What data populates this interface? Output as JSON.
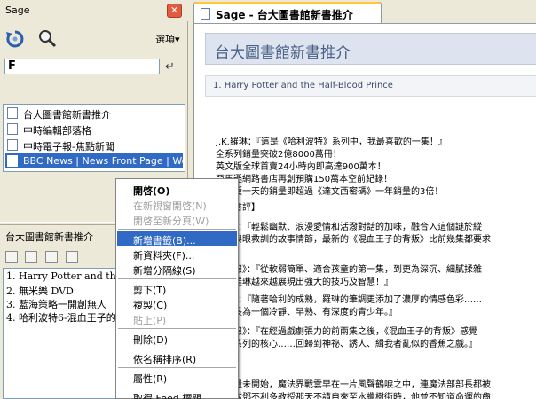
{
  "sidebar": {
    "title": "Sage",
    "close_glyph": "✕",
    "toolbar": {
      "refresh_icon": "refresh-icon",
      "search_icon": "search-icon",
      "options_label": "選項▾"
    },
    "filter": {
      "value": "F",
      "go_glyph": "↵"
    },
    "feeds": [
      {
        "label": "台大圖書館新書推介",
        "selected": false
      },
      {
        "label": "中時編輯部落格",
        "selected": false
      },
      {
        "label": "中時電子報-焦點新聞",
        "selected": false
      },
      {
        "label": "BBC News | News Front Page | World E",
        "selected": true
      }
    ],
    "item_list": {
      "title": "台大圖書館新書推介",
      "items": [
        "1. Harry Potter and the Ha",
        "2. 無米樂 DVD",
        "3. 藍海策略一開創無人",
        "4. 哈利波特6-混血王子的"
      ]
    }
  },
  "main": {
    "tab_label": "Sage - 台大圖書館新書推介",
    "page_title": "台大圖書館新書推介",
    "item_heading": "1.  Harry Potter and the Half-Blood Prince",
    "article_lines": [
      "J.K.羅琳：『這是《哈利波特》系列中，我最喜歡的一集！』",
      "全系列銷量突破2億8000萬冊！",
      "英文版全球首賣24小時內即高達900萬本！",
      "亞馬遜網路書店再創預購150萬本空前紀錄！",
      "英文版一天的銷量即超過《達文西密碼》一年銷量的3倍！",
      "重要書評】",
      "時報》：『輕鬆幽默、浪漫愛情和活潑對話的加味，融合入這個謎於縱",
      "誘和與眼救訓的故事情節，最新的《混血王子的背叛》比前幾集都要求",
      "」",
      "頂日報》：『從軟弱簡單、適合孩童的第一集，到更為深沉、細膩揉雜",
      "集，羅琳越來越展現出強大的技巧及智慧！』",
      "信報》：『隨著哈利的成熟，羅琳的筆調更添加了濃厚的情感色彩……",
      "漸成長為一個冷靜、早熟、有深度的青少年。』",
      "國日報》：『在經過戲劇張力的前兩集之後，《混血王子的背叛》感覺",
      "到了系列的核心……回歸到神祕、誘人、緝我者亂似的香蕉之戲。』",
      "簡介】",
      "季節還未開始，魔法界戰雲早在一片風聲鶴唳之中，連魔法部部長都被",
      "但是當鄧不利多教授那天不請自來至水蠟樹街時，他並不知道命運的齒"
    ]
  },
  "context_menu": {
    "items": [
      {
        "label": "開啓(O)",
        "type": "bold"
      },
      {
        "label": "在新視窗開啓(N)",
        "type": "disabled"
      },
      {
        "label": "開啓至新分頁(W)",
        "type": "disabled"
      },
      {
        "sep": true
      },
      {
        "label": "新增書籤(B)...",
        "type": "highlight"
      },
      {
        "label": "新資料夾(F)...",
        "type": "normal"
      },
      {
        "label": "新增分隔線(S)",
        "type": "normal"
      },
      {
        "sep": true
      },
      {
        "label": "剪下(T)",
        "type": "normal"
      },
      {
        "label": "複製(C)",
        "type": "normal"
      },
      {
        "label": "貼上(P)",
        "type": "disabled"
      },
      {
        "sep": true
      },
      {
        "label": "刪除(D)",
        "type": "normal"
      },
      {
        "sep": true
      },
      {
        "label": "依名稱排序(R)",
        "type": "normal"
      },
      {
        "sep": true
      },
      {
        "label": "屬性(R)",
        "type": "normal"
      },
      {
        "sep": true
      },
      {
        "label": "取得 Feed 標題",
        "type": "normal"
      }
    ]
  },
  "colors": {
    "selection": "#316ac5",
    "title_bar": "#dde4ef",
    "title_text": "#4a6086",
    "chrome": "#ece9d8"
  }
}
